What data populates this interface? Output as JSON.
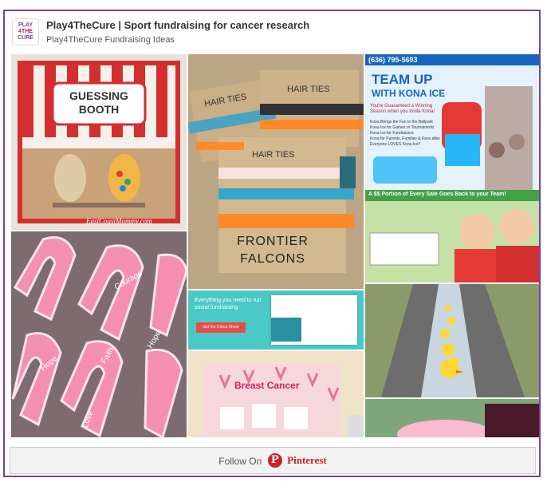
{
  "header": {
    "logo_line1": "PLAY",
    "logo_line2": "4THE",
    "logo_line3": "CURE",
    "title": "Play4TheCure | Sport fundraising for cancer research",
    "subtitle": "Play4TheCure Fundraising Ideas"
  },
  "pins": {
    "guessing_booth": {
      "sign": "GUESSING BOOTH",
      "watermark": "EastCoastMommy.com"
    },
    "hair_ties": {
      "label1": "HAIR TIES",
      "label2": "HAIR TIES",
      "label3": "HAIR TIES",
      "team": "FRONTIER FALCONS"
    },
    "kona_ice": {
      "phone": "(636) 795-5693",
      "headline1": "TEAM UP",
      "headline2": "WITH KONA ICE",
      "promo_top": "You're Guaranteed a Winning Season when you Invite Kona!",
      "bullets": [
        "Kona Brings the Fun to the Ballpark",
        "Kona Ice for Games or Tournaments",
        "Kona Ice for Fundraisers",
        "Kona for Parents, Families & Fans alike",
        "Everyone LOVES Kona Ice!!"
      ],
      "portion": "A $$ Portion of Every Sale Goes Back to your Team!"
    },
    "social_fundraising": {
      "headline": "Everything you need to run social fundraising",
      "button": "Get the Cheat Sheet"
    },
    "ribbon_board": {
      "heading": "Breast Cancer"
    },
    "cookies": {
      "words": [
        "Courage",
        "Faith",
        "Hope",
        "Love",
        "Hope"
      ]
    }
  },
  "footer": {
    "follow_label": "Follow On",
    "pinterest_icon": "P",
    "pinterest_label": "Pinterest"
  },
  "colors": {
    "border": "#7b3fa0",
    "pinterest": "#cb2027"
  }
}
